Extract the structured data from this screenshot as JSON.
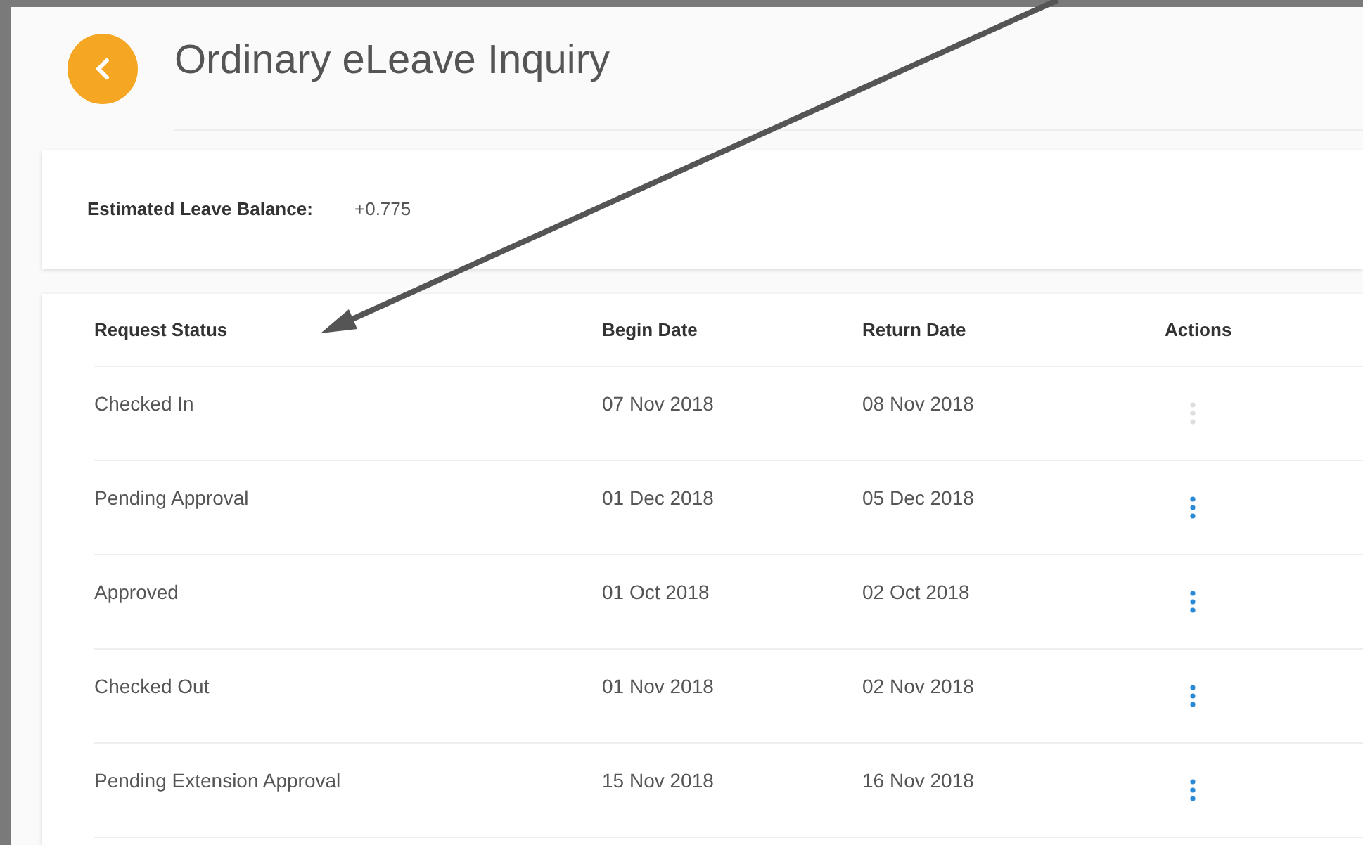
{
  "header": {
    "title": "Ordinary eLeave Inquiry"
  },
  "balance": {
    "label": "Estimated Leave Balance:",
    "value": "+0.775"
  },
  "table": {
    "columns": [
      "Request Status",
      "Begin Date",
      "Return Date",
      "Actions"
    ],
    "rows": [
      {
        "status": "Checked In",
        "begin": "07 Nov 2018",
        "return": "08 Nov 2018",
        "disabled": true
      },
      {
        "status": "Pending Approval",
        "begin": "01 Dec 2018",
        "return": "05 Dec 2018",
        "disabled": false
      },
      {
        "status": "Approved",
        "begin": "01 Oct 2018",
        "return": "02 Oct 2018",
        "disabled": false
      },
      {
        "status": "Checked Out",
        "begin": "01 Nov 2018",
        "return": "02 Nov 2018",
        "disabled": false
      },
      {
        "status": "Pending Extension Approval",
        "begin": "15 Nov 2018",
        "return": "16 Nov 2018",
        "disabled": false
      }
    ]
  }
}
